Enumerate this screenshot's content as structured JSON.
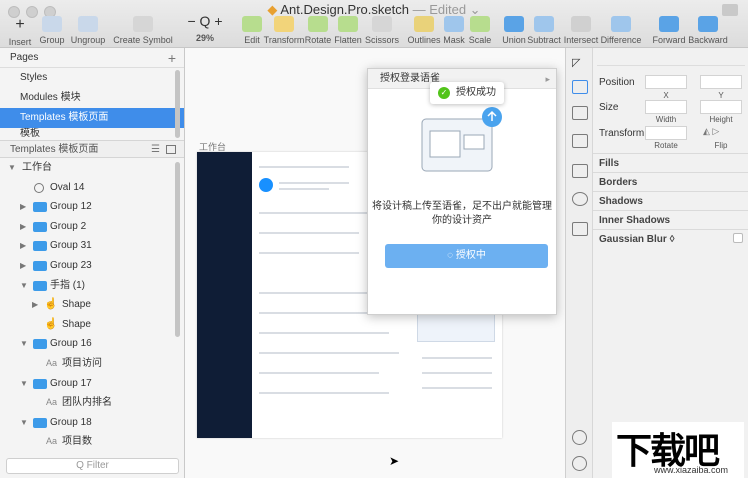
{
  "window": {
    "title": "Ant.Design.Pro.sketch",
    "edited": "— Edited ⌄"
  },
  "toolbar": {
    "insert": "Insert",
    "group": "Group",
    "ungroup": "Ungroup",
    "create_symbol": "Create Symbol",
    "zoom": "29%",
    "zoom_minus": "−",
    "zoom_plus": "+",
    "edit": "Edit",
    "transform": "Transform",
    "rotate": "Rotate",
    "flatten": "Flatten",
    "scissors": "Scissors",
    "outlines": "Outlines",
    "mask": "Mask",
    "scale": "Scale",
    "union": "Union",
    "subtract": "Subtract",
    "intersect": "Intersect",
    "difference": "Difference",
    "forward": "Forward",
    "backward": "Backward"
  },
  "sidebar": {
    "pages_title": "Pages",
    "pages": [
      {
        "label": "Styles"
      },
      {
        "label": "Modules 模块"
      },
      {
        "label": "Templates 模板页面"
      },
      {
        "label": "模板"
      }
    ],
    "layers_title": "Templates 模板页面",
    "layers": [
      {
        "label": "工作台"
      },
      {
        "label": "Oval 14"
      },
      {
        "label": "Group 12"
      },
      {
        "label": "Group 2"
      },
      {
        "label": "Group 31"
      },
      {
        "label": "Group 23"
      },
      {
        "label": "手指 (1)"
      },
      {
        "label": "Shape"
      },
      {
        "label": "Shape"
      },
      {
        "label": "Group 16"
      },
      {
        "label": "项目访问"
      },
      {
        "label": "Group 17"
      },
      {
        "label": "团队内排名"
      },
      {
        "label": "Group 18"
      },
      {
        "label": "项目数"
      }
    ],
    "filter_placeholder": "Filter"
  },
  "canvas": {
    "artboard_label": "工作台"
  },
  "modal": {
    "title": "授权登录语雀",
    "toast": "授权成功",
    "description_line1": "将设计稿上传至语雀，足不出户就能管理",
    "description_line2": "你的设计资产",
    "button": "授权中"
  },
  "inspector": {
    "position": "Position",
    "x": "X",
    "y": "Y",
    "size": "Size",
    "width": "Width",
    "height": "Height",
    "transform": "Transform",
    "rotate": "Rotate",
    "flip": "Flip",
    "sections": [
      "Fills",
      "Borders",
      "Shadows",
      "Inner Shadows",
      "Gaussian Blur ◊"
    ]
  },
  "watermark": {
    "main": "下载吧",
    "url": "www.xiazaiba.com"
  },
  "colors": {
    "accent": "#3f8dea",
    "folder": "#3d9be9",
    "button": "#6cb0f1",
    "success": "#52c41a"
  }
}
